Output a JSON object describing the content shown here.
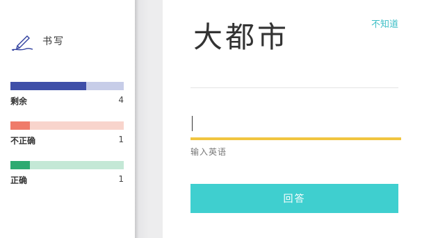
{
  "sidebar": {
    "mode": {
      "icon": "pen-writing-icon",
      "label": "书写"
    },
    "stats": [
      {
        "label": "剩余",
        "count": "4",
        "fraction": 0.67,
        "fill_color": "#3f4fa8",
        "track_color": "#c7cde8"
      },
      {
        "label": "不正确",
        "count": "1",
        "fraction": 0.17,
        "fill_color": "#ef7b6a",
        "track_color": "#f8d4cc"
      },
      {
        "label": "正确",
        "count": "1",
        "fraction": 0.17,
        "fill_color": "#2eaa71",
        "track_color": "#c4e8d6"
      }
    ]
  },
  "main": {
    "prompt": "大都市",
    "dont_know_label": "不知道",
    "input": {
      "value": "",
      "hint": "输入英语"
    },
    "submit_label": "回答",
    "accent_color": "#3fcfcf",
    "input_underline_color": "#f1c540"
  }
}
